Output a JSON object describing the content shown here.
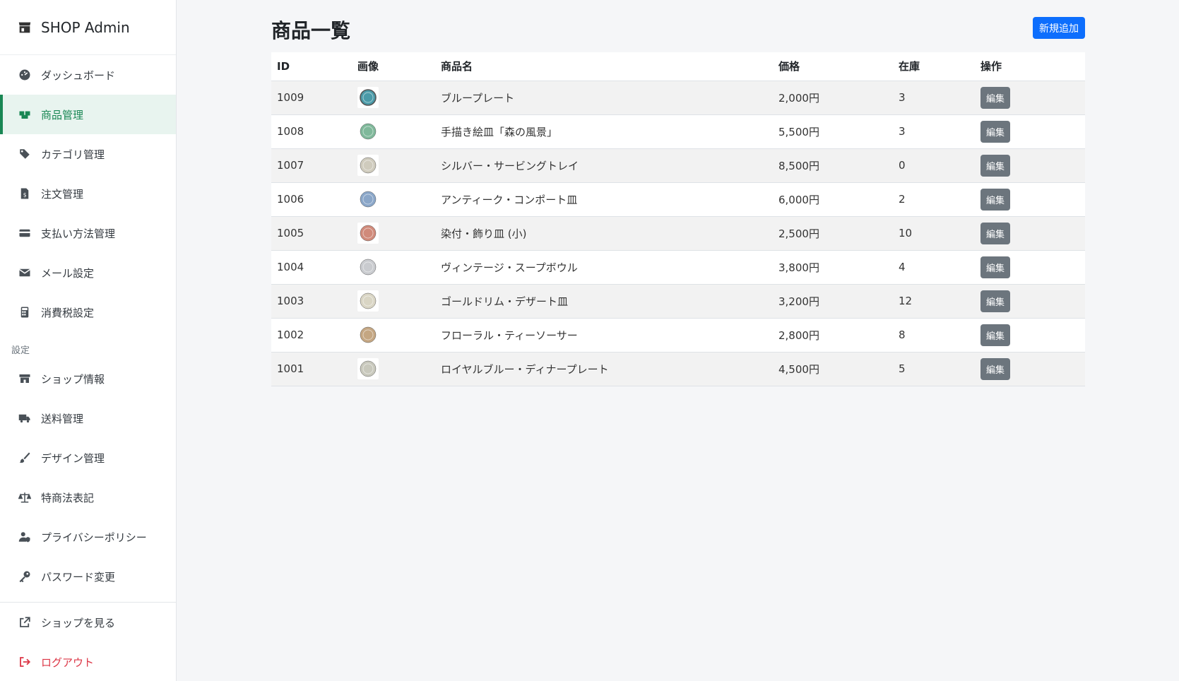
{
  "brand": {
    "title": "SHOP Admin",
    "icon": "store-icon"
  },
  "sidebar": {
    "items": [
      {
        "label": "ダッシュボード",
        "icon": "dashboard-icon"
      },
      {
        "label": "商品管理",
        "icon": "boxes-icon",
        "active": true
      },
      {
        "label": "カテゴリ管理",
        "icon": "tags-icon"
      },
      {
        "label": "注文管理",
        "icon": "invoice-icon"
      },
      {
        "label": "支払い方法管理",
        "icon": "credit-card-icon"
      },
      {
        "label": "メール設定",
        "icon": "envelope-icon"
      },
      {
        "label": "消費税設定",
        "icon": "calculator-icon"
      }
    ],
    "section_label": "設定",
    "settings_items": [
      {
        "label": "ショップ情報",
        "icon": "shop-icon"
      },
      {
        "label": "送料管理",
        "icon": "truck-icon"
      },
      {
        "label": "デザイン管理",
        "icon": "brush-icon"
      },
      {
        "label": "特商法表記",
        "icon": "scale-icon"
      },
      {
        "label": "プライバシーポリシー",
        "icon": "user-shield-icon"
      },
      {
        "label": "パスワード変更",
        "icon": "key-icon"
      }
    ],
    "bottom_items": [
      {
        "label": "ショップを見る",
        "icon": "external-link-icon"
      },
      {
        "label": "ログアウト",
        "icon": "logout-icon"
      }
    ]
  },
  "main": {
    "title": "商品一覧",
    "add_button": "新規追加",
    "table": {
      "headers": [
        "ID",
        "画像",
        "商品名",
        "価格",
        "在庫",
        "操作"
      ],
      "edit_label": "編集",
      "rows": [
        {
          "id": "1009",
          "name": "ブループレート",
          "price": "2,000円",
          "stock": "3",
          "thumb_color": "#4a9aa8"
        },
        {
          "id": "1008",
          "name": "手描き絵皿「森の風景」",
          "price": "5,500円",
          "stock": "3",
          "thumb_color": "#7fb89a"
        },
        {
          "id": "1007",
          "name": "シルバー・サービングトレイ",
          "price": "8,500円",
          "stock": "0",
          "thumb_color": "#cfcbbd"
        },
        {
          "id": "1006",
          "name": "アンティーク・コンポート皿",
          "price": "6,000円",
          "stock": "2",
          "thumb_color": "#8aa6c8"
        },
        {
          "id": "1005",
          "name": "染付・飾り皿 (小)",
          "price": "2,500円",
          "stock": "10",
          "thumb_color": "#d08a7a"
        },
        {
          "id": "1004",
          "name": "ヴィンテージ・スープボウル",
          "price": "3,800円",
          "stock": "4",
          "thumb_color": "#c9cbcf"
        },
        {
          "id": "1003",
          "name": "ゴールドリム・デザート皿",
          "price": "3,200円",
          "stock": "12",
          "thumb_color": "#d9d5c4"
        },
        {
          "id": "1002",
          "name": "フローラル・ティーソーサー",
          "price": "2,800円",
          "stock": "8",
          "thumb_color": "#c4a682"
        },
        {
          "id": "1001",
          "name": "ロイヤルブルー・ディナープレート",
          "price": "4,500円",
          "stock": "5",
          "thumb_color": "#c8c8bc"
        }
      ]
    }
  }
}
